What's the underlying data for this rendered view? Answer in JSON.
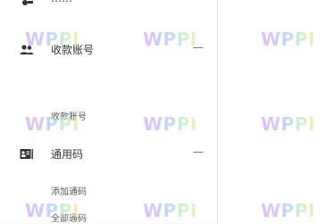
{
  "menu": {
    "top_partial_label": "……",
    "groups": [
      {
        "icon": "users-icon",
        "label": "收款账号",
        "collapse_symbol": "—",
        "subitems": [
          "收款账号"
        ]
      },
      {
        "icon": "contact-card-icon",
        "label": "通用码",
        "collapse_symbol": "—",
        "subitems": [
          "添加通码",
          "全部通码"
        ]
      }
    ]
  },
  "watermark": {
    "text": "WPPI"
  }
}
